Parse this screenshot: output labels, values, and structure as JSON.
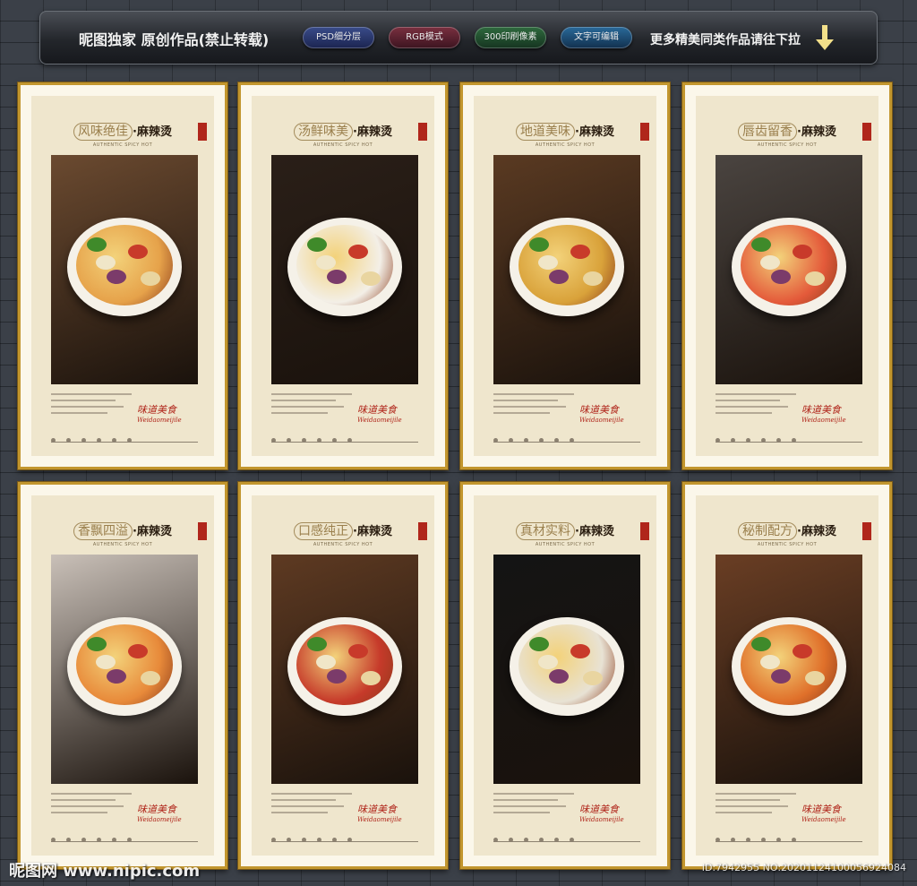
{
  "header": {
    "brand": "昵图独家 原创作品(禁止转载)",
    "badges": [
      "PSD细分层",
      "RGB模式",
      "300印刷像素",
      "文字可编辑"
    ],
    "more": "更多精美同类作品请往下拉"
  },
  "posters": [
    {
      "title": "风味绝佳",
      "dish": "·麻辣烫",
      "subtitle": "AUTHENTIC SPICY HOT",
      "signature": "味道美食",
      "signature_en": "Weidaomeijile",
      "bg": "#6b4a30",
      "bowl": "#e6a24a"
    },
    {
      "title": "汤鲜味美",
      "dish": "·麻辣烫",
      "subtitle": "AUTHENTIC SPICY HOT",
      "signature": "味道美食",
      "signature_en": "Weidaomeijile",
      "bg": "#2a1f18",
      "bowl": "#f3efe7"
    },
    {
      "title": "地道美味",
      "dish": "·麻辣烫",
      "subtitle": "AUTHENTIC SPICY HOT",
      "signature": "味道美食",
      "signature_en": "Weidaomeijile",
      "bg": "#5a3a22",
      "bowl": "#d9a23a"
    },
    {
      "title": "唇齿留香",
      "dish": "·麻辣烫",
      "subtitle": "AUTHENTIC SPICY HOT",
      "signature": "味道美食",
      "signature_en": "Weidaomeijile",
      "bg": "#4a4440",
      "bowl": "#e45a3a"
    },
    {
      "title": "香飘四溢",
      "dish": "·麻辣烫",
      "subtitle": "AUTHENTIC SPICY HOT",
      "signature": "味道美食",
      "signature_en": "Weidaomeijile",
      "bg": "#c9c0b8",
      "bowl": "#e88a3a"
    },
    {
      "title": "口感纯正",
      "dish": "·麻辣烫",
      "subtitle": "AUTHENTIC SPICY HOT",
      "signature": "味道美食",
      "signature_en": "Weidaomeijile",
      "bg": "#5e3a22",
      "bowl": "#c63a2a"
    },
    {
      "title": "真材实料",
      "dish": "·麻辣烫",
      "subtitle": "AUTHENTIC SPICY HOT",
      "signature": "味道美食",
      "signature_en": "Weidaomeijile",
      "bg": "#141414",
      "bowl": "#e8e2d4"
    },
    {
      "title": "秘制配方",
      "dish": "·麻辣烫",
      "subtitle": "AUTHENTIC SPICY HOT",
      "signature": "味道美食",
      "signature_en": "Weidaomeijile",
      "bg": "#6a3e24",
      "bowl": "#e0702a"
    }
  ],
  "watermark": {
    "site": "昵图网 www.nipic.com",
    "id": "ID:7942955 NO:20201124100056924084"
  }
}
